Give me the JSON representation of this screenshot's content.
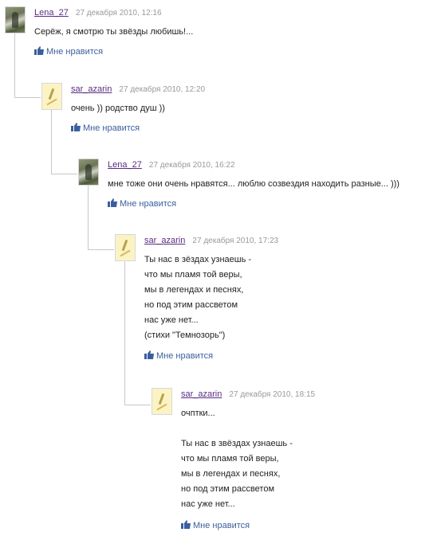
{
  "like_label": "Мне нравится",
  "comments": [
    {
      "author": "Lena_27",
      "date": "27 декабря 2010, 12:16",
      "text": "Серёж, я смотрю ты звёзды любишь!..."
    },
    {
      "author": "sar_azarin",
      "date": "27 декабря 2010, 12:20",
      "text": "очень )) родство душ ))"
    },
    {
      "author": "Lena_27",
      "date": "27 декабря 2010, 16:22",
      "text": "мне тоже они очень нравятся... люблю созвездия находить разные... )))"
    },
    {
      "author": "sar_azarin",
      "date": "27 декабря 2010, 17:23",
      "text": "Ты нас в зёздах узнаешь -\nчто мы пламя той веры,\nмы в легендах и песнях,\nно под этим рассветом\nнас уже нет...\n(стихи \"Темнозорь\")"
    },
    {
      "author": "sar_azarin",
      "date": "27 декабря 2010, 18:15",
      "text": "очптки...\n\nТы нас в звёздах узнаешь -\nчто мы пламя той веры,\nмы в легендах и песнях,\nно под этим рассветом\nнас уже нет..."
    }
  ]
}
